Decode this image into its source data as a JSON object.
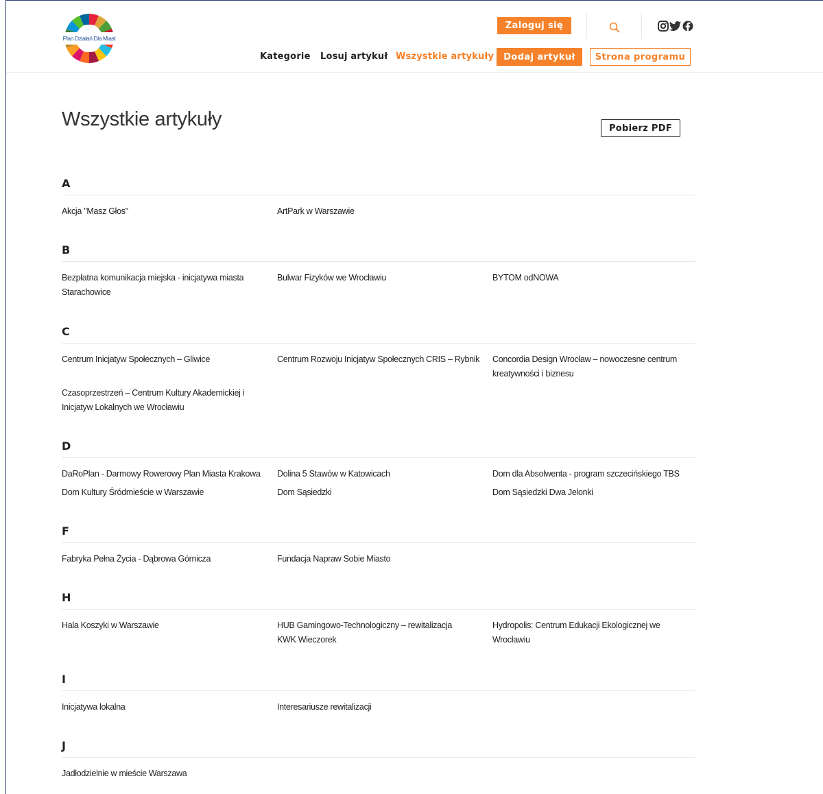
{
  "header": {
    "logo_text": "Plan Działań Dla Miast",
    "login_label": "Zaloguj się",
    "nav": [
      "Kategorie",
      "Losuj artykuł",
      "Wszystkie artykuły"
    ],
    "add_article_label": "Dodaj artykuł",
    "program_label": "Strona programu",
    "accent_color": "#f5822a"
  },
  "main": {
    "title": "Wszystkie artykuły",
    "pdf_label": "Pobierz PDF"
  },
  "sections": [
    {
      "letter": "A",
      "items": [
        "Akcja \"Masz Głos\"",
        "ArtPark w Warszawie"
      ]
    },
    {
      "letter": "B",
      "items": [
        "Bezpłatna komunikacja miejska - inicjatywa miasta Starachowice",
        "Bulwar Fizyków we Wrocławiu",
        "BYTOM odNOWA"
      ]
    },
    {
      "letter": "C",
      "items": [
        "Centrum Inicjatyw Społecznych – Gliwice",
        "Centrum Rozwoju Inicjatyw Społecznych CRIS – Rybnik",
        "Concordia Design Wrocław – nowoczesne centrum kreatywności i biznesu",
        "Czasoprzestrzeń – Centrum Kultury Akademickiej i Inicjatyw Lokalnych we Wrocławiu"
      ]
    },
    {
      "letter": "D",
      "items": [
        "DaRoPlan - Darmowy Rowerowy Plan Miasta Krakowa",
        "Dolina 5 Stawów w Katowicach",
        "Dom dla Absolwenta - program szczecińskiego TBS",
        "Dom Kultury Śródmieście w Warszawie",
        "Dom Sąsiedzki",
        "Dom Sąsiedzki Dwa Jelonki"
      ]
    },
    {
      "letter": "F",
      "items": [
        "Fabryka Pełna Życia - Dąbrowa Górnicza",
        "Fundacja Napraw Sobie Miasto"
      ]
    },
    {
      "letter": "H",
      "items": [
        "Hala Koszyki w Warszawie",
        "HUB Gamingowo-Technologiczny – rewitalizacja KWK Wieczorek",
        "Hydropolis: Centrum Edukacji Ekologicznej we Wrocławiu"
      ]
    },
    {
      "letter": "I",
      "items": [
        "Inicjatywa lokalna",
        "Interesariusze rewitalizacji"
      ]
    },
    {
      "letter": "J",
      "items": [
        "Jadłodzielnie w mieście Warszawa"
      ]
    }
  ]
}
